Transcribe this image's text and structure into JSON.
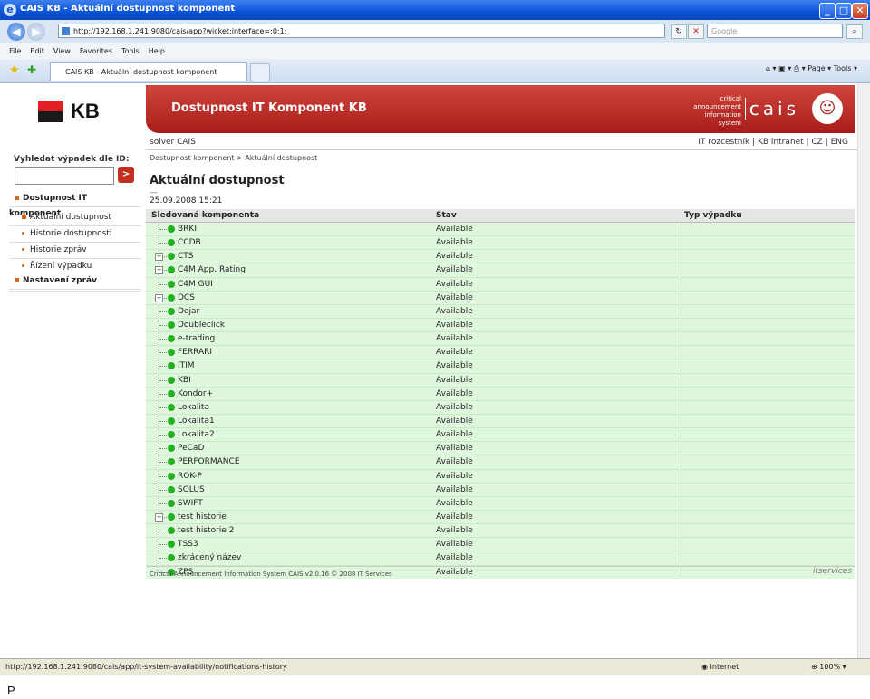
{
  "window": {
    "title": "CAIS KB - Aktuální dostupnost komponent",
    "min": "_",
    "max": "□",
    "close": "✕"
  },
  "browser": {
    "url": "http://192.168.1.241:9080/cais/app?wicket:interface=:0:1:",
    "search_placeholder": "Google",
    "menu": [
      "File",
      "Edit",
      "View",
      "Favorites",
      "Tools",
      "Help"
    ],
    "tab_title": "CAIS KB - Aktuální dostupnost komponent",
    "tools_text": "Page ▾  Tools ▾"
  },
  "header": {
    "logo_text": "KB",
    "banner_title": "Dostupnost IT Komponent KB",
    "banner_small": "critical announcement information system",
    "banner_brand": "cais",
    "solver": "solver CAIS",
    "top_links": "IT rozcestník | KB intranet | CZ | ENG"
  },
  "sidebar": {
    "search_label": "Vyhledat výpadek dle ID:",
    "search_button": ">",
    "items": [
      {
        "label": "Dostupnost IT komponent",
        "kind": "main"
      },
      {
        "label": "Aktuální dostupnost",
        "kind": "sub-active"
      },
      {
        "label": "Historie dostupnosti",
        "kind": "sub"
      },
      {
        "label": "Historie zpráv",
        "kind": "sub"
      },
      {
        "label": "Řízení výpadku",
        "kind": "sub"
      },
      {
        "label": "Nastavení zpráv",
        "kind": "main"
      }
    ]
  },
  "content": {
    "breadcrumb": "Dostupnost komponent > Aktuální dostupnost",
    "heading": "Aktuální dostupnost",
    "dashes": "---",
    "date": "25.09.2008 15:21",
    "columns": [
      "Sledovaná komponenta",
      "Stav",
      "Typ výpadku"
    ],
    "rows": [
      {
        "name": "BRKI",
        "status": "Available",
        "expandable": false
      },
      {
        "name": "CCDB",
        "status": "Available",
        "expandable": false
      },
      {
        "name": "CTS",
        "status": "Available",
        "expandable": true
      },
      {
        "name": "C4M App. Rating",
        "status": "Available",
        "expandable": true
      },
      {
        "name": "C4M GUI",
        "status": "Available",
        "expandable": false
      },
      {
        "name": "DCS",
        "status": "Available",
        "expandable": true
      },
      {
        "name": "Dejar",
        "status": "Available",
        "expandable": false
      },
      {
        "name": "Doubleclick",
        "status": "Available",
        "expandable": false
      },
      {
        "name": "e-trading",
        "status": "Available",
        "expandable": false
      },
      {
        "name": "FERRARI",
        "status": "Available",
        "expandable": false
      },
      {
        "name": "ITIM",
        "status": "Available",
        "expandable": false
      },
      {
        "name": "KBI",
        "status": "Available",
        "expandable": false
      },
      {
        "name": "Kondor+",
        "status": "Available",
        "expandable": false
      },
      {
        "name": "Lokalita",
        "status": "Available",
        "expandable": false
      },
      {
        "name": "Lokalita1",
        "status": "Available",
        "expandable": false
      },
      {
        "name": "Lokalita2",
        "status": "Available",
        "expandable": false
      },
      {
        "name": "PeCaD",
        "status": "Available",
        "expandable": false
      },
      {
        "name": "PERFORMANCE",
        "status": "Available",
        "expandable": false
      },
      {
        "name": "ROK-P",
        "status": "Available",
        "expandable": false
      },
      {
        "name": "SOLUS",
        "status": "Available",
        "expandable": false
      },
      {
        "name": "SWIFT",
        "status": "Available",
        "expandable": false
      },
      {
        "name": "test historie",
        "status": "Available",
        "expandable": true
      },
      {
        "name": "test historie 2",
        "status": "Available",
        "expandable": false
      },
      {
        "name": "TSS3",
        "status": "Available",
        "expandable": false
      },
      {
        "name": "zkrácený název",
        "status": "Available",
        "expandable": false
      },
      {
        "name": "ZPS",
        "status": "Available",
        "expandable": false
      }
    ],
    "status_color": "#22b022",
    "row_bg": "#dff7dd"
  },
  "footer": {
    "text": "Critical Announcement Information System CAIS v2.0.16 © 2008 IT Services",
    "brand": "itservices"
  },
  "statusbar": {
    "url": "http://192.168.1.241:9080/cais/app/it-system-availability/notifications-history",
    "zone": "Internet",
    "zoom": "100%"
  },
  "below": "P"
}
